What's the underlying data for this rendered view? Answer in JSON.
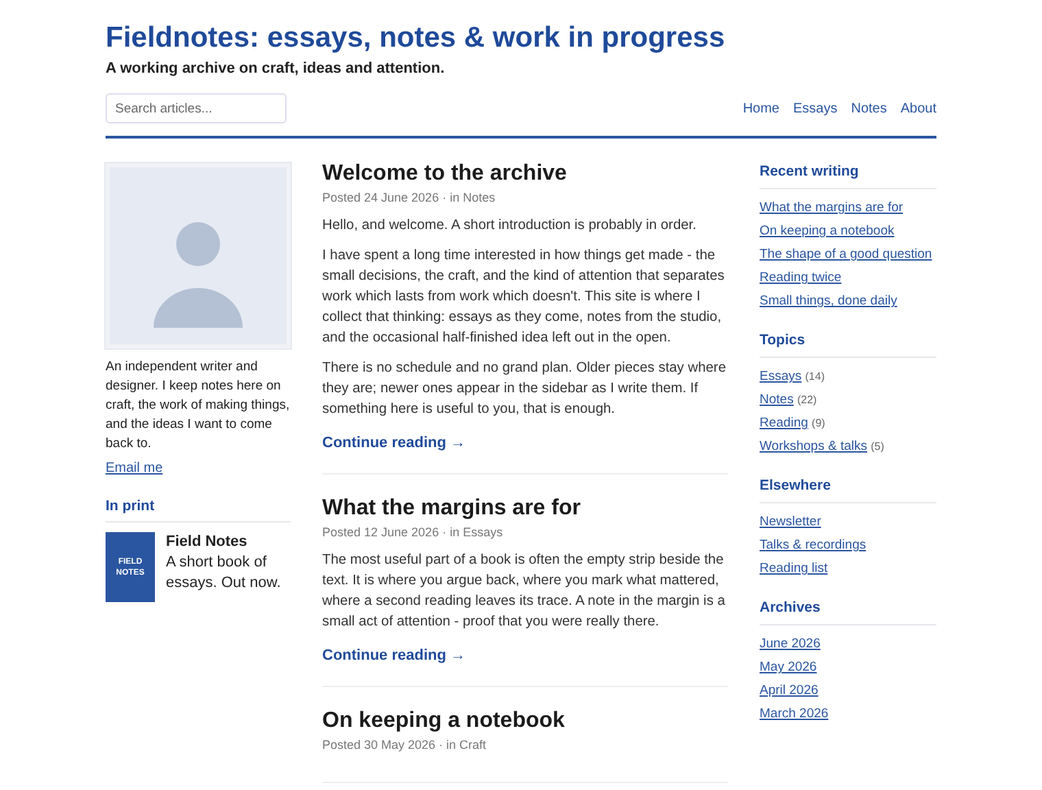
{
  "site": {
    "title": "Fieldnotes: essays, notes & work in progress",
    "tagline": "A working archive on craft, ideas and attention."
  },
  "search": {
    "placeholder": "Search articles..."
  },
  "nav": [
    {
      "label": "Home"
    },
    {
      "label": "Essays"
    },
    {
      "label": "Notes"
    },
    {
      "label": "About"
    }
  ],
  "profile": {
    "bio": "An independent writer and designer. I keep notes here on craft, the work of making things, and the ideas I want to come back to.",
    "link": "Email me"
  },
  "in_print": {
    "heading": "In print",
    "cover_text": "FIELD NOTES",
    "title": "Field Notes",
    "description": "A short book of essays. Out now."
  },
  "posts": [
    {
      "title": "Welcome to the archive",
      "meta": "Posted 24 June 2026 · in Notes",
      "paragraphs": [
        "Hello, and welcome. A short introduction is probably in order.",
        "I have spent a long time interested in how things get made - the small decisions, the craft, and the kind of attention that separates work which lasts from work which doesn't. This site is where I collect that thinking: essays as they come, notes from the studio, and the occasional half-finished idea left out in the open.",
        "There is no schedule and no grand plan. Older pieces stay where they are; newer ones appear in the sidebar as I write them. If something here is useful to you, that is enough."
      ],
      "more": "Continue reading →"
    },
    {
      "title": "What the margins are for",
      "meta": "Posted 12 June 2026 · in Essays",
      "paragraphs": [
        "The most useful part of a book is often the empty strip beside the text. It is where you argue back, where you mark what mattered, where a second reading leaves its trace. A note in the margin is a small act of attention - proof that you were really there."
      ],
      "more": "Continue reading →"
    },
    {
      "title": "On keeping a notebook",
      "meta": "Posted 30 May 2026 · in Craft"
    }
  ],
  "sidebar": [
    {
      "heading": "Recent writing",
      "links": [
        {
          "label": "What the margins are for"
        },
        {
          "label": "On keeping a notebook"
        },
        {
          "label": "The shape of a good question"
        },
        {
          "label": "Reading twice"
        },
        {
          "label": "Small things, done daily"
        }
      ]
    },
    {
      "heading": "Topics",
      "links": [
        {
          "label": "Essays",
          "count": "(14)"
        },
        {
          "label": "Notes",
          "count": "(22)"
        },
        {
          "label": "Reading",
          "count": "(9)"
        },
        {
          "label": "Workshops & talks",
          "count": "(5)"
        }
      ]
    },
    {
      "heading": "Elsewhere",
      "links": [
        {
          "label": "Newsletter"
        },
        {
          "label": "Talks & recordings"
        },
        {
          "label": "Reading list"
        }
      ]
    },
    {
      "heading": "Archives",
      "links": [
        {
          "label": "June 2026"
        },
        {
          "label": "May 2026"
        },
        {
          "label": "April 2026"
        },
        {
          "label": "March 2026"
        }
      ]
    }
  ]
}
